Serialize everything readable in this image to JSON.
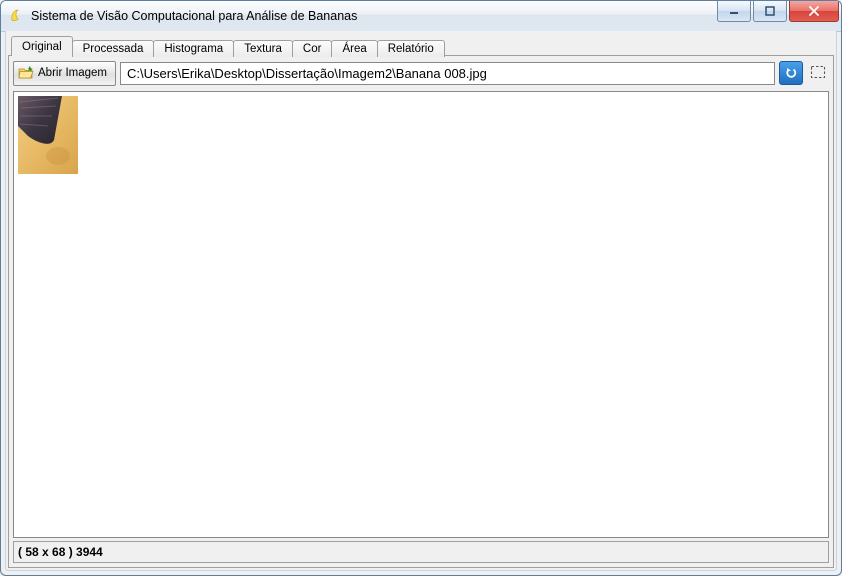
{
  "window": {
    "title": "Sistema de Visão Computacional para Análise de Bananas"
  },
  "tabs": [
    {
      "label": "Original",
      "active": true
    },
    {
      "label": "Processada",
      "active": false
    },
    {
      "label": "Histograma",
      "active": false
    },
    {
      "label": "Textura",
      "active": false
    },
    {
      "label": "Cor",
      "active": false
    },
    {
      "label": "Área",
      "active": false
    },
    {
      "label": "Relatório",
      "active": false
    }
  ],
  "toolbar": {
    "open_label": "Abrir Imagem",
    "path_value": "C:\\Users\\Erika\\Desktop\\Dissertação\\Imagem2\\Banana 008.jpg"
  },
  "status": {
    "text": "( 58 x 68 ) 3944"
  }
}
